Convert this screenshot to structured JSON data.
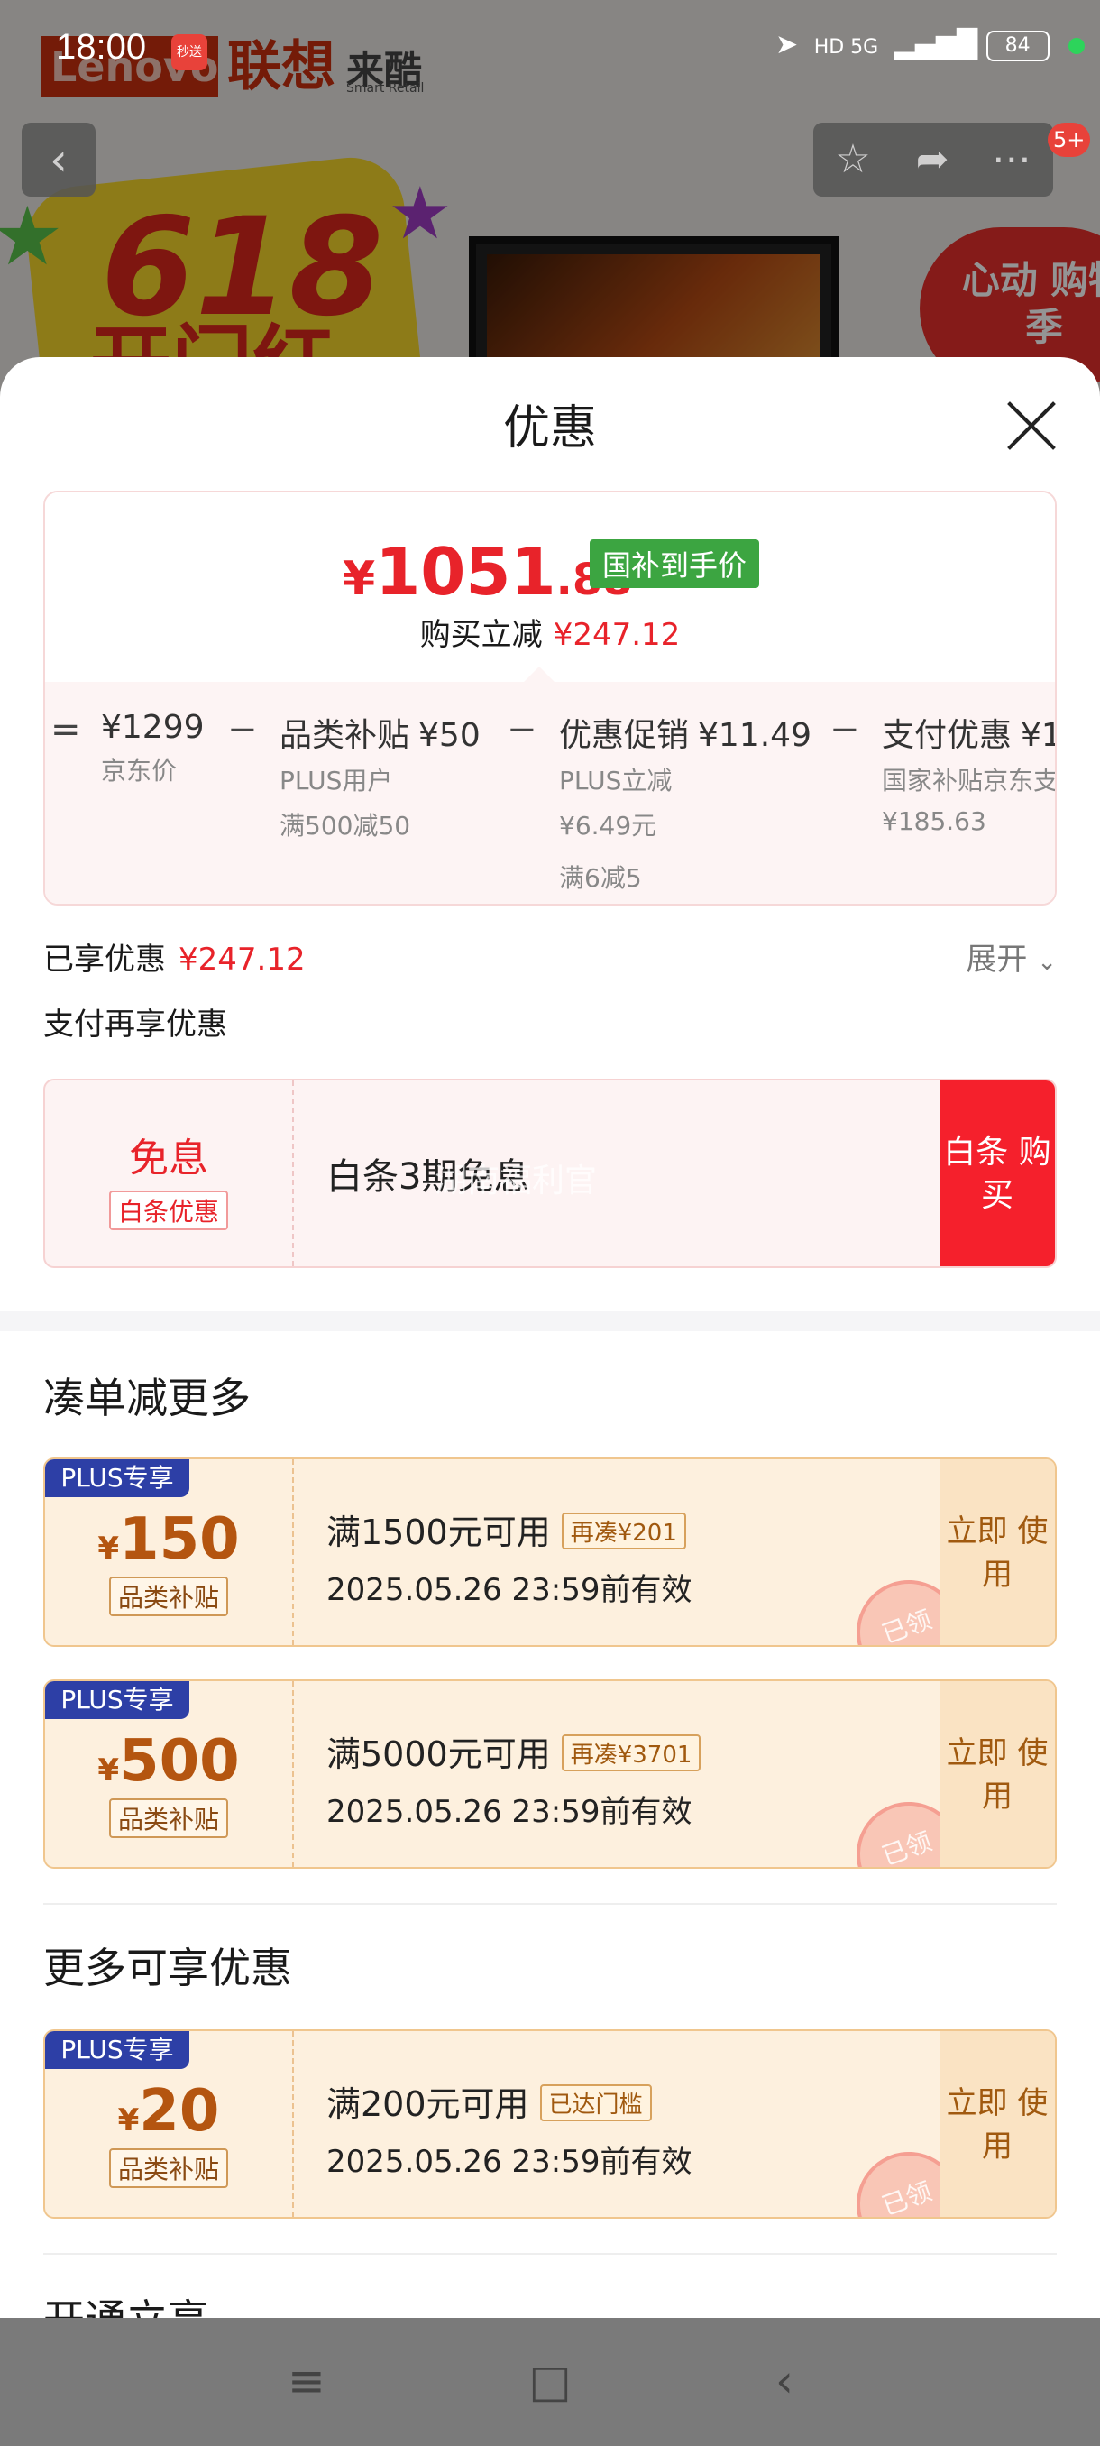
{
  "status_bar": {
    "time": "18:00",
    "app_icon": "秒送",
    "network": "HD 5G",
    "battery": "84"
  },
  "background": {
    "brand_en": "Lenovo",
    "brand_cn": "联想",
    "brand_cn2": "来酷",
    "brand_sub": "Smart Retail",
    "promo_618": "618",
    "promo_618_sub": "开门红",
    "promo_right": "心动 购物季",
    "badge_count": "5+"
  },
  "sheet": {
    "title": "优惠",
    "price": {
      "yen": "¥",
      "int": "1051",
      "dec": ".88"
    },
    "subsidy_badge": "国补到手价",
    "instant_label": "购买立减",
    "instant_amount": "¥247.12",
    "breakdown": {
      "eq": "=",
      "jd_price": "¥1299",
      "jd_label": "京东价",
      "minus": "−",
      "cat_label": "品类补贴",
      "cat_value": "¥50",
      "cat_sub1": "PLUS用户",
      "cat_sub2": "满500减50",
      "promo_label": "优惠促销",
      "promo_value": "¥11.49",
      "promo_sub1": "PLUS立减",
      "promo_sub2": "¥6.49元",
      "promo_sub3": "满6减5",
      "pay_label": "支付优惠",
      "pay_value": "¥1",
      "pay_sub1": "国家补贴京东支",
      "pay_sub2": "¥185.63"
    },
    "enjoyed_label": "已享优惠",
    "enjoyed_amount": "¥247.12",
    "expand_label": "展开",
    "pay_more_label": "支付再享优惠",
    "baitiao": {
      "title": "免息",
      "tag": "白条优惠",
      "desc": "白条3期免息",
      "watermark": "湖南福利官",
      "button": "白条 购买"
    },
    "section_more": "凑单减更多",
    "coupons_more": [
      {
        "plus": "PLUS专享",
        "yen": "¥",
        "amount": "150",
        "tag": "品类补贴",
        "condition": "满1500元可用",
        "chip": "再凑¥201",
        "expiry": "2025.05.26 23:59前有效",
        "button": "立即 使用",
        "stamp": "已领"
      },
      {
        "plus": "PLUS专享",
        "yen": "¥",
        "amount": "500",
        "tag": "品类补贴",
        "condition": "满5000元可用",
        "chip": "再凑¥3701",
        "expiry": "2025.05.26 23:59前有效",
        "button": "立即 使用",
        "stamp": "已领"
      }
    ],
    "section_available": "更多可享优惠",
    "coupons_available": [
      {
        "plus": "PLUS专享",
        "yen": "¥",
        "amount": "20",
        "tag": "品类补贴",
        "condition": "满200元可用",
        "chip": "已达门槛",
        "expiry": "2025.05.26 23:59前有效",
        "button": "立即 使用",
        "stamp": "已领"
      }
    ],
    "section_open": "开通立享"
  },
  "nav": {
    "menu": "≡",
    "home": "□",
    "back": "‹"
  }
}
